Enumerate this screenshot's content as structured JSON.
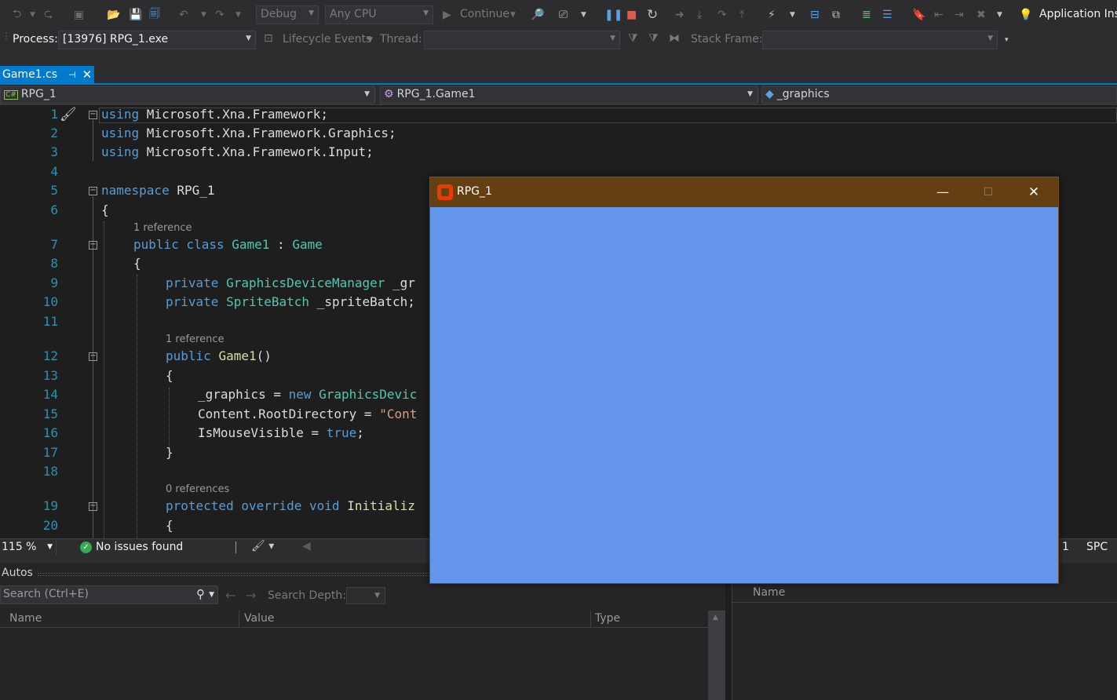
{
  "toolbar": {
    "config": "Debug",
    "platform": "Any CPU",
    "continue_label": "Continue",
    "app_insights_label": "Application Ins"
  },
  "debug_bar": {
    "process_label": "Process:",
    "process_value": "[13976] RPG_1.exe",
    "lifecycle_label": "Lifecycle Events",
    "thread_label": "Thread:",
    "stack_frame_label": "Stack Frame:"
  },
  "tabs": [
    {
      "label": "Game1.cs",
      "active": true
    }
  ],
  "navbar": {
    "project": "RPG_1",
    "class_scope": "RPG_1.Game1",
    "member": "_graphics",
    "lang_badge": "C#"
  },
  "editor": {
    "lines": [
      "1",
      "2",
      "3",
      "4",
      "5",
      "6",
      "7",
      "8",
      "9",
      "10",
      "11",
      "12",
      "13",
      "14",
      "15",
      "16",
      "17",
      "18",
      "19",
      "20"
    ],
    "refs": {
      "class_ref": "1 reference",
      "ctor_ref": "1 reference",
      "init_ref": "0 references"
    },
    "code": {
      "l1_kw": "using",
      "l1_rest": " Microsoft.Xna.Framework;",
      "l2_kw": "using",
      "l2_rest": " Microsoft.Xna.Framework.Graphics;",
      "l3_kw": "using",
      "l3_rest": " Microsoft.Xna.Framework.Input;",
      "l5_kw": "namespace",
      "l5_rest": " RPG_1",
      "l6": "{",
      "l7_kw": "public class",
      "l7_ty": "Game1",
      "l7_sep": " : ",
      "l7_base": "Game",
      "l8": "{",
      "l9_kw": "private",
      "l9_ty": "GraphicsDeviceManager",
      "l9_rest": " _gr",
      "l10_kw": "private",
      "l10_ty": "SpriteBatch",
      "l10_rest": " _spriteBatch;",
      "l12_kw": "public",
      "l12_ty": "Game1",
      "l12_rest": "()",
      "l13": "{",
      "l14_a": "_graphics = ",
      "l14_kw": "new",
      "l14_ty": "GraphicsDevic",
      "l15_a": "Content.RootDirectory = ",
      "l15_st": "\"Cont",
      "l16_a": "IsMouseVisible = ",
      "l16_kw": "true",
      "l16_b": ";",
      "l17": "}",
      "l19_kw": "protected override void",
      "l19_fn": "Initializ",
      "l20": "{"
    }
  },
  "status": {
    "zoom": "115 %",
    "issues": "No issues found",
    "col": "1",
    "spacing": "SPC"
  },
  "autos": {
    "title": "Autos",
    "search_placeholder": "Search (Ctrl+E)",
    "search_depth_label": "Search Depth:",
    "columns": [
      "Name",
      "Value",
      "Type"
    ]
  },
  "right_pane": {
    "columns": [
      "Name"
    ]
  },
  "game_window": {
    "title": "RPG_1",
    "client_color": "#6495ED",
    "titlebar_color": "#643F12",
    "min_glyph": "—",
    "max_glyph": "☐",
    "close_glyph": "✕"
  }
}
